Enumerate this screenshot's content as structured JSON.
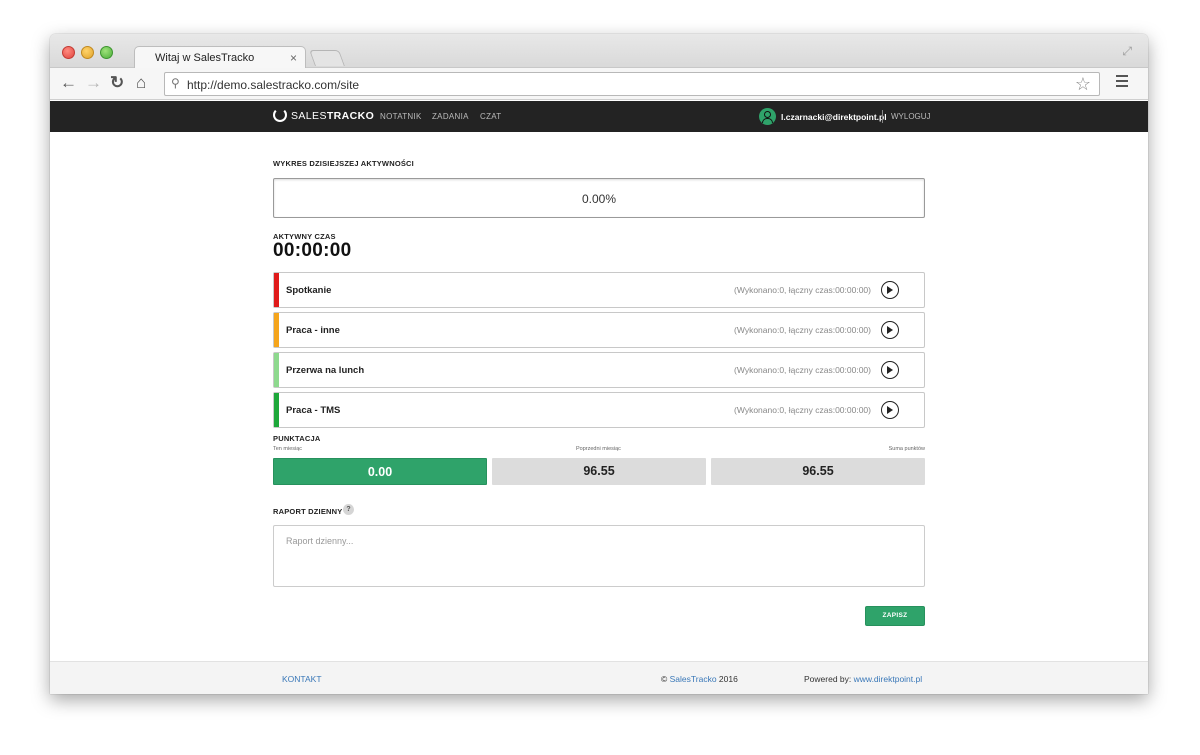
{
  "browser": {
    "tab_title": "Witaj w SalesTracko",
    "tab_close": "×",
    "url": "http://demo.salestracko.com/site"
  },
  "nav": {
    "logo_light": "SALES",
    "logo_bold": "TRACKO",
    "links": [
      "NOTATNIK",
      "ZADANIA",
      "CZAT"
    ],
    "user_email": "l.czarnacki@direktpoint.pl",
    "logout": "WYLOGUJ"
  },
  "activity_chart": {
    "title": "WYKRES DZISIEJSZEJ AKTYWNOŚCI",
    "progress": 0.0,
    "progress_label": "0.00%"
  },
  "active_time": {
    "label": "AKTYWNY CZAS",
    "value": "00:00:00"
  },
  "activities": [
    {
      "name": "Spotkanie",
      "stats": "(Wykonano:0, łączny czas:00:00:00)",
      "color": "#e01b1b"
    },
    {
      "name": "Praca - inne",
      "stats": "(Wykonano:0, łączny czas:00:00:00)",
      "color": "#f5a51c"
    },
    {
      "name": "Przerwa na lunch",
      "stats": "(Wykonano:0, łączny czas:00:00:00)",
      "color": "#8ed98e"
    },
    {
      "name": "Praca - TMS",
      "stats": "(Wykonano:0, łączny czas:00:00:00)",
      "color": "#1ea83a"
    }
  ],
  "points": {
    "title": "PUNKTACJA",
    "captions": [
      "Ten miesiąc",
      "Poprzedni miesiąc",
      "Suma punktów"
    ],
    "values": [
      "0.00",
      "96.55",
      "96.55"
    ]
  },
  "report": {
    "title": "RAPORT DZIENNY",
    "help": "?",
    "placeholder": "Raport dzienny...",
    "save_label": "ZAPISZ"
  },
  "footer": {
    "contact": "KONTAKT",
    "copy_prefix": "© ",
    "copy_link": "SalesTracko",
    "copy_suffix": " 2016",
    "powered_prefix": "Powered by: ",
    "powered_link": "www.direktpoint.pl"
  }
}
